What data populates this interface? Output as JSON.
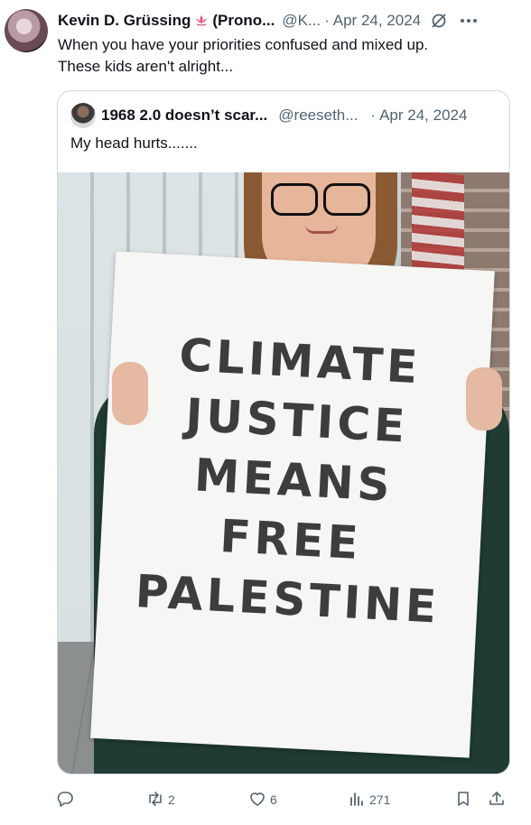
{
  "tweet": {
    "author_name": "Kevin D. Grüssing",
    "author_suffix": "(Prono...",
    "handle": "@K...",
    "date": "Apr 24, 2024",
    "text_line1": "When you have your priorities confused and mixed up.",
    "text_line2": "These kids aren't alright..."
  },
  "quote": {
    "author_name": "1968 2.0 doesn’t scar...",
    "handle": "@reeseth...",
    "date": "Apr 24, 2024",
    "text": "My head hurts.......",
    "sign_lines": [
      "CLIMATE",
      "JUSTICE",
      "MEANS",
      "FREE",
      "PALESTINE"
    ]
  },
  "actions": {
    "reply_count": "",
    "retweet_count": "2",
    "like_count": "6",
    "views_count": "271"
  },
  "icons": {
    "name_badge": "lotus-icon",
    "grok": "grok-icon",
    "more": "more-icon",
    "reply": "reply-icon",
    "retweet": "retweet-icon",
    "like": "heart-icon",
    "views": "views-icon",
    "bookmark": "bookmark-icon",
    "share": "share-icon"
  },
  "colors": {
    "secondary_text": "#536471",
    "border": "#cfd9de",
    "badge": "#e0567a"
  }
}
